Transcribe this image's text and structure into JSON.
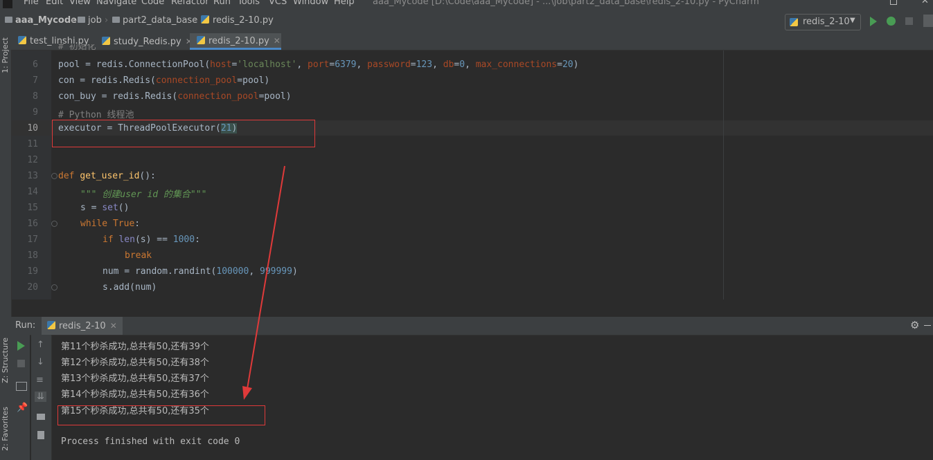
{
  "menu": [
    "File",
    "Edit",
    "View",
    "Navigate",
    "Code",
    "Refactor",
    "Run",
    "Tools",
    "VCS",
    "Window",
    "Help"
  ],
  "window_title": "aaa_Mycode [D:\\Code\\aaa_Mycode] - ...\\job\\part2_data_base\\redis_2-10.py - PyCharm",
  "breadcrumb": [
    "aaa_Mycode",
    "job",
    "part2_data_base",
    "redis_2-10.py"
  ],
  "run_config": "redis_2-10",
  "tabs": [
    "test_linshi.py",
    "study_Redis.py",
    "redis_2-10.py"
  ],
  "tool_windows": {
    "project": "1: Project",
    "structure": "Z: Structure",
    "favorites": "2: Favorites"
  },
  "editor": {
    "top_partial": "# 初始化",
    "lines": [
      {
        "n": "6"
      },
      {
        "n": "7"
      },
      {
        "n": "8"
      },
      {
        "n": "9"
      },
      {
        "n": "10"
      },
      {
        "n": "11"
      },
      {
        "n": "12"
      },
      {
        "n": "13"
      },
      {
        "n": "14"
      },
      {
        "n": "15"
      },
      {
        "n": "16"
      },
      {
        "n": "17"
      },
      {
        "n": "18"
      },
      {
        "n": "19"
      },
      {
        "n": "20"
      }
    ],
    "l6": {
      "a": "pool = redis.ConnectionPool(",
      "p1": "host",
      "eq1": "=",
      "s1": "'localhost'",
      ", ": ", ",
      "p2": "port",
      "n2": "6379",
      "p3": "password",
      "n3": "123",
      "p4": "db",
      "n4": "0",
      "p5": "max_connections",
      "n5": "20",
      ")": ")"
    },
    "l7": {
      "a": "con = redis.Redis(",
      "p": "connection_pool",
      "b": "=pool)"
    },
    "l8": {
      "a": "con_buy = redis.Redis(",
      "p": "connection_pool",
      "b": "=pool)"
    },
    "l9": "# Python 线程池",
    "l10": {
      "a": "executor = ThreadPoolExecutor(",
      "n": "21",
      "b": ")"
    },
    "l13": {
      "kw": "def ",
      "fn": "get_user_id",
      "b": "():"
    },
    "l14": "\"\"\" 创建user id 的集合\"\"\"",
    "l15": {
      "a": "s = ",
      "bi": "set",
      "b": "()"
    },
    "l16": {
      "kw": "while ",
      "kw2": "True",
      "b": ":"
    },
    "l17": {
      "kw": "if ",
      "bi": "len",
      "a": "(s) == ",
      "n": "1000",
      "b": ":"
    },
    "l18": "break",
    "l19": {
      "a": "num = random.randint(",
      "n1": "100000",
      "c": ", ",
      "n2": "999999",
      "b": ")"
    },
    "l20": "s.add(num)"
  },
  "run_panel": {
    "label": "Run:",
    "tab": "redis_2-10",
    "output": [
      "第11个秒杀成功,总共有50,还有39个",
      "第12个秒杀成功,总共有50,还有38个",
      "第13个秒杀成功,总共有50,还有37个",
      "第14个秒杀成功,总共有50,还有36个",
      "第15个秒杀成功,总共有50,还有35个"
    ],
    "exit_message": "Process finished with exit code 0"
  },
  "colors": {
    "annotation": "#e03a3a",
    "accent": "#4a88c7",
    "run_green": "#499c54"
  }
}
